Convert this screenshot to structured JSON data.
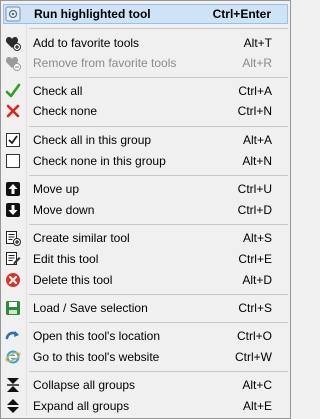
{
  "menu": {
    "run": {
      "label": "Run highlighted tool",
      "shortcut": "Ctrl+Enter",
      "icon": "run-icon"
    },
    "add_fav": {
      "label": "Add to favorite tools",
      "shortcut": "Alt+T",
      "icon": "heart-add-icon"
    },
    "remove_fav": {
      "label": "Remove from favorite tools",
      "shortcut": "Alt+R",
      "icon": "heart-remove-icon"
    },
    "check_all": {
      "label": "Check all",
      "shortcut": "Ctrl+A",
      "icon": "checkmark-icon"
    },
    "check_none": {
      "label": "Check none",
      "shortcut": "Ctrl+N",
      "icon": "cross-icon"
    },
    "check_all_group": {
      "label": "Check all in this group",
      "shortcut": "Alt+A",
      "icon": "checked-box-icon"
    },
    "check_none_group": {
      "label": "Check none in this group",
      "shortcut": "Alt+N",
      "icon": "empty-box-icon"
    },
    "move_up": {
      "label": "Move up",
      "shortcut": "Ctrl+U",
      "icon": "arrow-up-icon"
    },
    "move_down": {
      "label": "Move down",
      "shortcut": "Ctrl+D",
      "icon": "arrow-down-icon"
    },
    "create_similar": {
      "label": "Create similar tool",
      "shortcut": "Alt+S",
      "icon": "create-tool-icon"
    },
    "edit_tool": {
      "label": "Edit this tool",
      "shortcut": "Ctrl+E",
      "icon": "edit-tool-icon"
    },
    "delete_tool": {
      "label": "Delete this tool",
      "shortcut": "Alt+D",
      "icon": "delete-icon"
    },
    "load_save": {
      "label": "Load / Save selection",
      "shortcut": "Ctrl+S",
      "icon": "save-icon"
    },
    "open_location": {
      "label": "Open this tool's location",
      "shortcut": "Ctrl+O",
      "icon": "open-location-icon"
    },
    "go_website": {
      "label": "Go to this tool's website",
      "shortcut": "Ctrl+W",
      "icon": "web-icon"
    },
    "collapse_all": {
      "label": "Collapse all groups",
      "shortcut": "Alt+C",
      "icon": "collapse-icon"
    },
    "expand_all": {
      "label": "Expand all groups",
      "shortcut": "Alt+E",
      "icon": "expand-icon"
    }
  },
  "colors": {
    "highlight_bg": "#cfe3f6",
    "highlight_border": "#99c1e8",
    "disabled_text": "#8a8a8a",
    "menu_bg": "#f0f0f0"
  }
}
